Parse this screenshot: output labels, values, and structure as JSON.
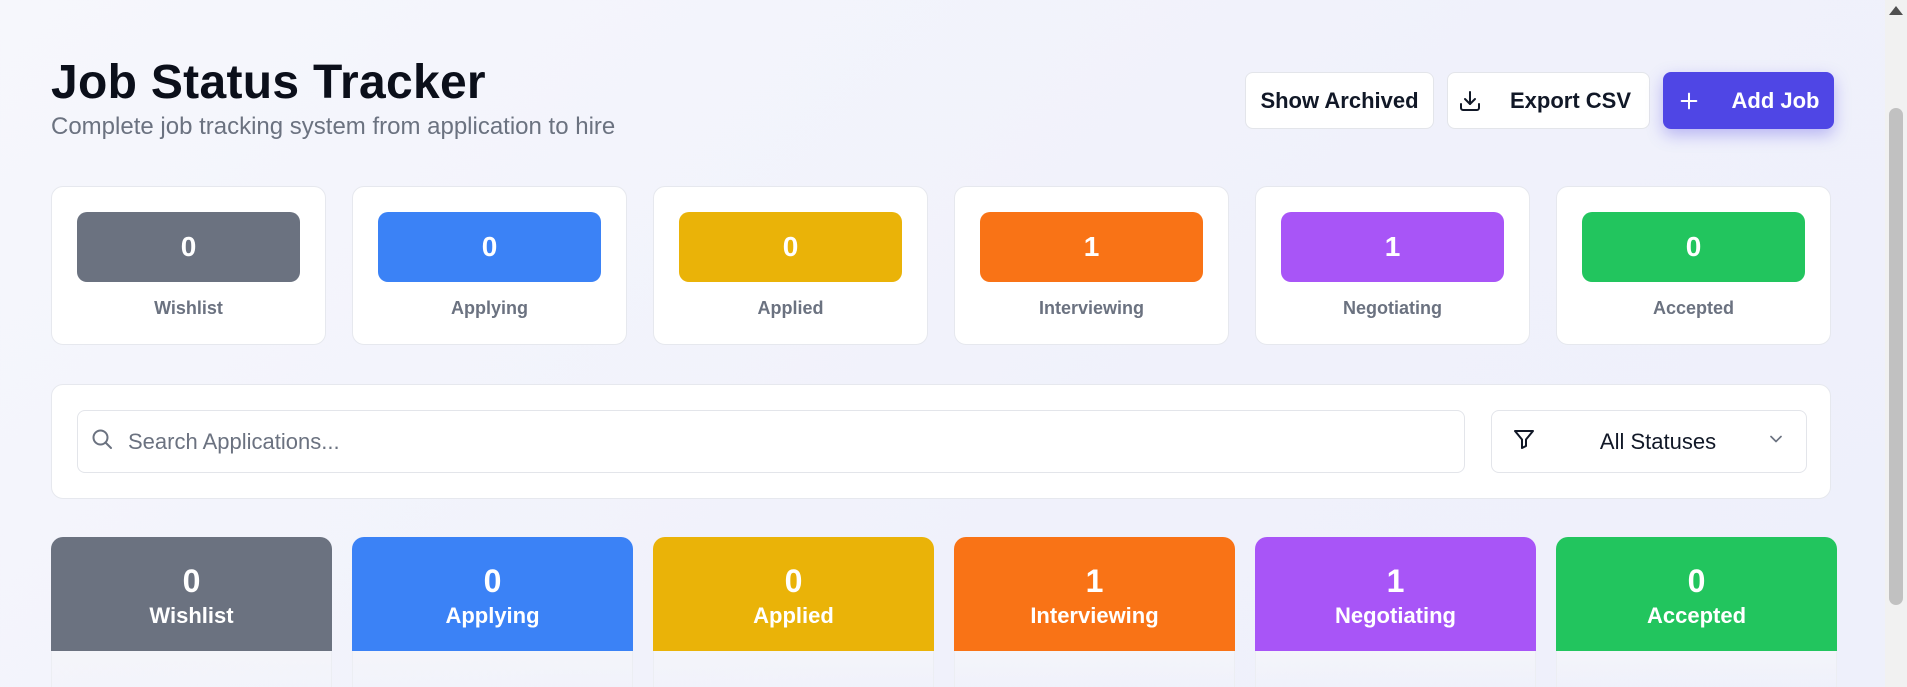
{
  "header": {
    "title": "Job Status Tracker",
    "subtitle": "Complete job tracking system from application to hire"
  },
  "actions": {
    "show_archived": "Show Archived",
    "export_csv": "Export CSV",
    "add_job": "Add Job"
  },
  "stats": [
    {
      "label": "Wishlist",
      "count": "0",
      "color": "#6b7280"
    },
    {
      "label": "Applying",
      "count": "0",
      "color": "#3b82f6"
    },
    {
      "label": "Applied",
      "count": "0",
      "color": "#eab308"
    },
    {
      "label": "Interviewing",
      "count": "1",
      "color": "#f97316"
    },
    {
      "label": "Negotiating",
      "count": "1",
      "color": "#a855f7"
    },
    {
      "label": "Accepted",
      "count": "0",
      "color": "#22c55e"
    }
  ],
  "search": {
    "placeholder": "Search Applications...",
    "value": ""
  },
  "filter": {
    "selected": "All Statuses"
  },
  "columns": [
    {
      "title": "Wishlist",
      "count": "0",
      "color": "#6b7280"
    },
    {
      "title": "Applying",
      "count": "0",
      "color": "#3b82f6"
    },
    {
      "title": "Applied",
      "count": "0",
      "color": "#eab308"
    },
    {
      "title": "Interviewing",
      "count": "1",
      "color": "#f97316"
    },
    {
      "title": "Negotiating",
      "count": "1",
      "color": "#a855f7"
    },
    {
      "title": "Accepted",
      "count": "0",
      "color": "#22c55e"
    }
  ],
  "colors": {
    "accent": "#4f46e5"
  }
}
